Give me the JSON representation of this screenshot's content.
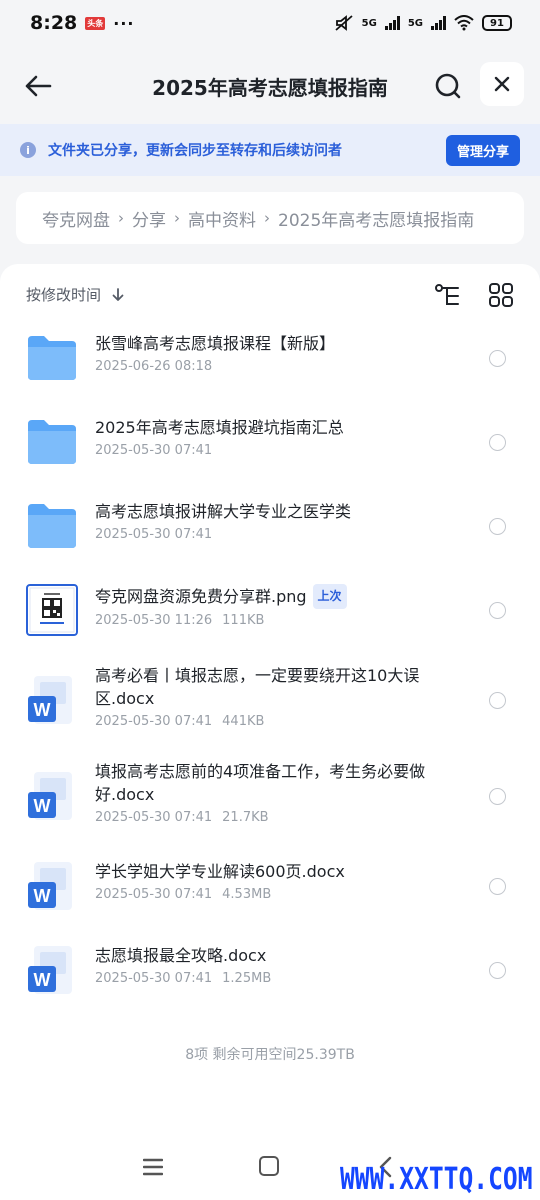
{
  "status_bar": {
    "time": "8:28",
    "badge": "头条",
    "dots": "···",
    "network_1": "5G",
    "network_2": "5G",
    "battery": "91"
  },
  "header": {
    "title": "2025年高考志愿填报指南"
  },
  "banner": {
    "text": "文件夹已分享，更新会同步至转存和后续访问者",
    "manage_label": "管理分享"
  },
  "breadcrumb": {
    "items": [
      "夸克网盘",
      "分享",
      "高中资料",
      "2025年高考志愿填报指南"
    ]
  },
  "sort": {
    "label": "按修改时间"
  },
  "files": [
    {
      "name": "张雪峰高考志愿填报课程【新版】",
      "date": "2025-06-26 08:18",
      "size": "",
      "type": "folder"
    },
    {
      "name": "2025年高考志愿填报避坑指南汇总",
      "date": "2025-05-30 07:41",
      "size": "",
      "type": "folder"
    },
    {
      "name": "高考志愿填报讲解大学专业之医学类",
      "date": "2025-05-30 07:41",
      "size": "",
      "type": "folder"
    },
    {
      "name": "夸克网盘资源免费分享群.png",
      "date": "2025-05-30 11:26",
      "size": "111KB",
      "type": "image",
      "tag": "上次"
    },
    {
      "name": "高考必看丨填报志愿，一定要要绕开这10大误区.docx",
      "date": "2025-05-30 07:41",
      "size": "441KB",
      "type": "docx"
    },
    {
      "name": "填报高考志愿前的4项准备工作，考生务必要做好.docx",
      "date": "2025-05-30 07:41",
      "size": "21.7KB",
      "type": "docx"
    },
    {
      "name": "学长学姐大学专业解读600页.docx",
      "date": "2025-05-30 07:41",
      "size": "4.53MB",
      "type": "docx"
    },
    {
      "name": "志愿填报最全攻略.docx",
      "date": "2025-05-30 07:41",
      "size": "1.25MB",
      "type": "docx"
    }
  ],
  "summary": "8项 剩余可用空间25.39TB",
  "watermark": "WWW.XXTTQ.COM",
  "colors": {
    "accent": "#1f5fe0",
    "banner_bg": "#e8eefb",
    "folder": "#5aa7f7"
  }
}
